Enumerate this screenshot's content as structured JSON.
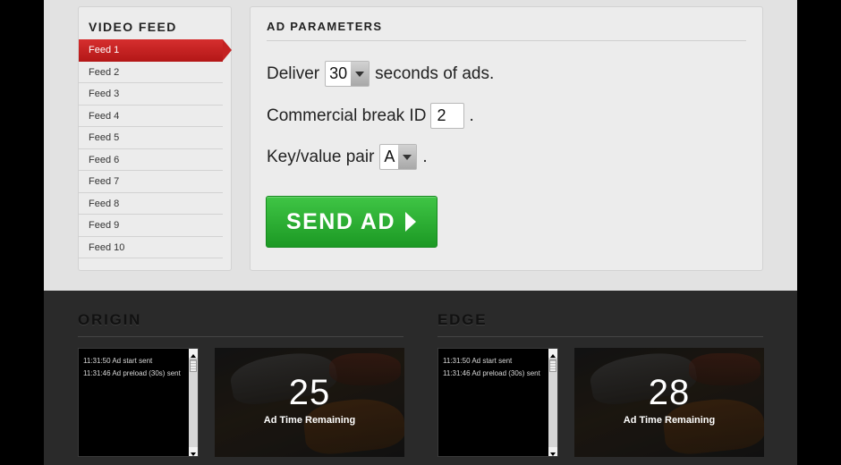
{
  "video_feed": {
    "title": "VIDEO FEED",
    "items": [
      {
        "label": "Feed 1",
        "active": true
      },
      {
        "label": "Feed 2"
      },
      {
        "label": "Feed 3"
      },
      {
        "label": "Feed 4"
      },
      {
        "label": "Feed 5"
      },
      {
        "label": "Feed 6"
      },
      {
        "label": "Feed 7"
      },
      {
        "label": "Feed 8"
      },
      {
        "label": "Feed 9"
      },
      {
        "label": "Feed 10"
      }
    ]
  },
  "ad_parameters": {
    "title": "AD PARAMETERS",
    "deliver_prefix": "Deliver",
    "deliver_value": "30",
    "deliver_suffix": "seconds of ads.",
    "break_label": "Commercial break ID",
    "break_value": "2",
    "break_suffix": ".",
    "kv_label": "Key/value pair",
    "kv_value": "A",
    "kv_suffix": ".",
    "send_label": "SEND AD"
  },
  "origin": {
    "title": "ORIGIN",
    "log": [
      "11:31:50 Ad start sent",
      "11:31:46 Ad preload (30s) sent"
    ],
    "remaining": "25",
    "remaining_label": "Ad Time Remaining"
  },
  "edge": {
    "title": "EDGE",
    "log": [
      "11:31:50 Ad start sent",
      "11:31:46 Ad preload (30s) sent"
    ],
    "remaining": "28",
    "remaining_label": "Ad Time Remaining"
  },
  "colors": {
    "accent_red": "#c42222",
    "send_green": "#2bb533"
  },
  "icons": {
    "select_arrow": "chevron-down-icon",
    "send_arrow": "play-arrow-icon"
  }
}
